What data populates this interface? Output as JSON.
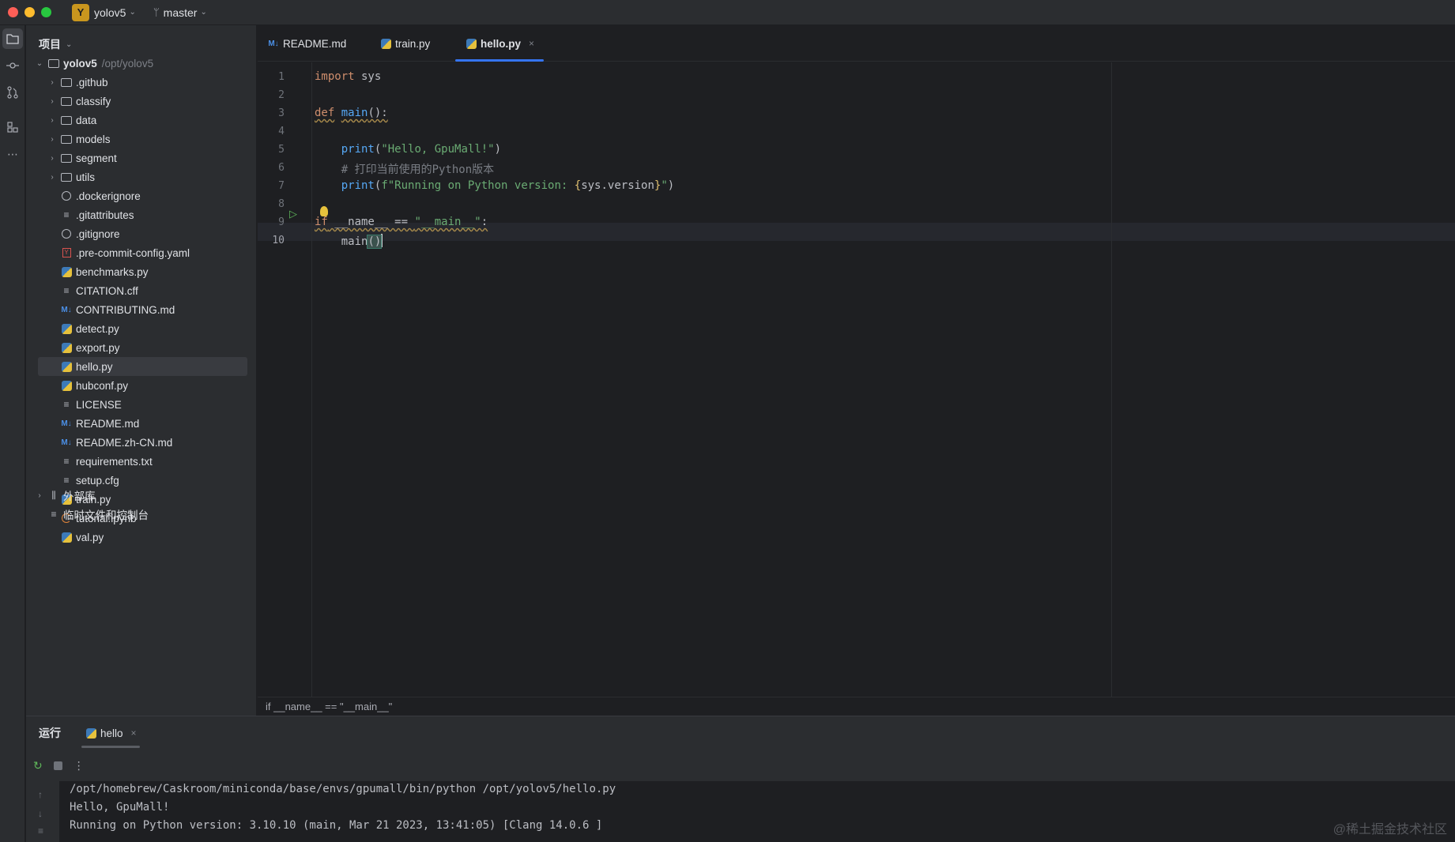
{
  "titlebar": {
    "project_badge": "Y",
    "project_name": "yolov5",
    "branch": "master",
    "traffic_colors": [
      "#fe5f57",
      "#febc2e",
      "#28c840"
    ]
  },
  "stripe": {
    "icons": [
      "folder-icon",
      "commit-icon",
      "pull-request-icon",
      "structure-icon",
      "more-icon"
    ]
  },
  "project": {
    "title": "项目",
    "root_name": "yolov5",
    "root_path": "/opt/yolov5",
    "items": [
      {
        "label": ".github",
        "kind": "folder"
      },
      {
        "label": "classify",
        "kind": "folder"
      },
      {
        "label": "data",
        "kind": "folder"
      },
      {
        "label": "models",
        "kind": "folder"
      },
      {
        "label": "segment",
        "kind": "folder"
      },
      {
        "label": "utils",
        "kind": "folder"
      },
      {
        "label": ".dockerignore",
        "kind": "ignore"
      },
      {
        "label": ".gitattributes",
        "kind": "text"
      },
      {
        "label": ".gitignore",
        "kind": "ignore"
      },
      {
        "label": ".pre-commit-config.yaml",
        "kind": "yaml"
      },
      {
        "label": "benchmarks.py",
        "kind": "py"
      },
      {
        "label": "CITATION.cff",
        "kind": "text"
      },
      {
        "label": "CONTRIBUTING.md",
        "kind": "md"
      },
      {
        "label": "detect.py",
        "kind": "py"
      },
      {
        "label": "export.py",
        "kind": "py"
      },
      {
        "label": "hello.py",
        "kind": "py"
      },
      {
        "label": "hubconf.py",
        "kind": "py"
      },
      {
        "label": "LICENSE",
        "kind": "text"
      },
      {
        "label": "README.md",
        "kind": "md"
      },
      {
        "label": "README.zh-CN.md",
        "kind": "md"
      },
      {
        "label": "requirements.txt",
        "kind": "text"
      },
      {
        "label": "setup.cfg",
        "kind": "text"
      },
      {
        "label": "train.py",
        "kind": "py"
      },
      {
        "label": "tutorial.ipynb",
        "kind": "ipynb"
      },
      {
        "label": "val.py",
        "kind": "py"
      }
    ],
    "external_libs": "外部库",
    "scratches": "临时文件和控制台",
    "md_badge": "M↓",
    "yaml_badge": "Y"
  },
  "editor": {
    "tabs": [
      {
        "label": "README.md",
        "badge": "M↓"
      },
      {
        "label": "train.py"
      },
      {
        "label": "hello.py",
        "active": true
      }
    ],
    "close_glyph": "×",
    "line_numbers": [
      "1",
      "2",
      "3",
      "4",
      "5",
      "6",
      "7",
      "8",
      "9",
      "10"
    ],
    "code": {
      "l1_kw": "import",
      "l1_rest": " sys",
      "l3_kw": "def",
      "l3_fn": "main",
      "l3_rest": "():",
      "l5_fn": "print",
      "l5_open": "(",
      "l5_str": "\"Hello, GpuMall!\"",
      "l5_close": ")",
      "l6_cmt": "# 打印当前使用的Python版本",
      "l7_fn": "print",
      "l7_open": "(",
      "l7_str_a": "f\"Running on Python version: ",
      "l7_brace_open": "{",
      "l7_expr": "sys.version",
      "l7_brace_close": "}",
      "l7_str_b": "\"",
      "l7_close": ")",
      "l9_kw": "if",
      "l9_rest": " __name__ == ",
      "l9_str": "\"__main__\"",
      "l9_colon": ":",
      "l10_call": "main",
      "l10_paren": "()"
    }
  },
  "breadcrumb": "if __name__ == \"__main__\"",
  "run": {
    "title": "运行",
    "tab_label": "hello",
    "console": [
      "/opt/homebrew/Caskroom/miniconda/base/envs/gpumall/bin/python /opt/yolov5/hello.py",
      "Hello, GpuMall!",
      "Running on Python version: 3.10.10 (main, Mar 21 2023, 13:41:05) [Clang 14.0.6 ]"
    ]
  },
  "watermark": "@稀土掘金技术社区"
}
